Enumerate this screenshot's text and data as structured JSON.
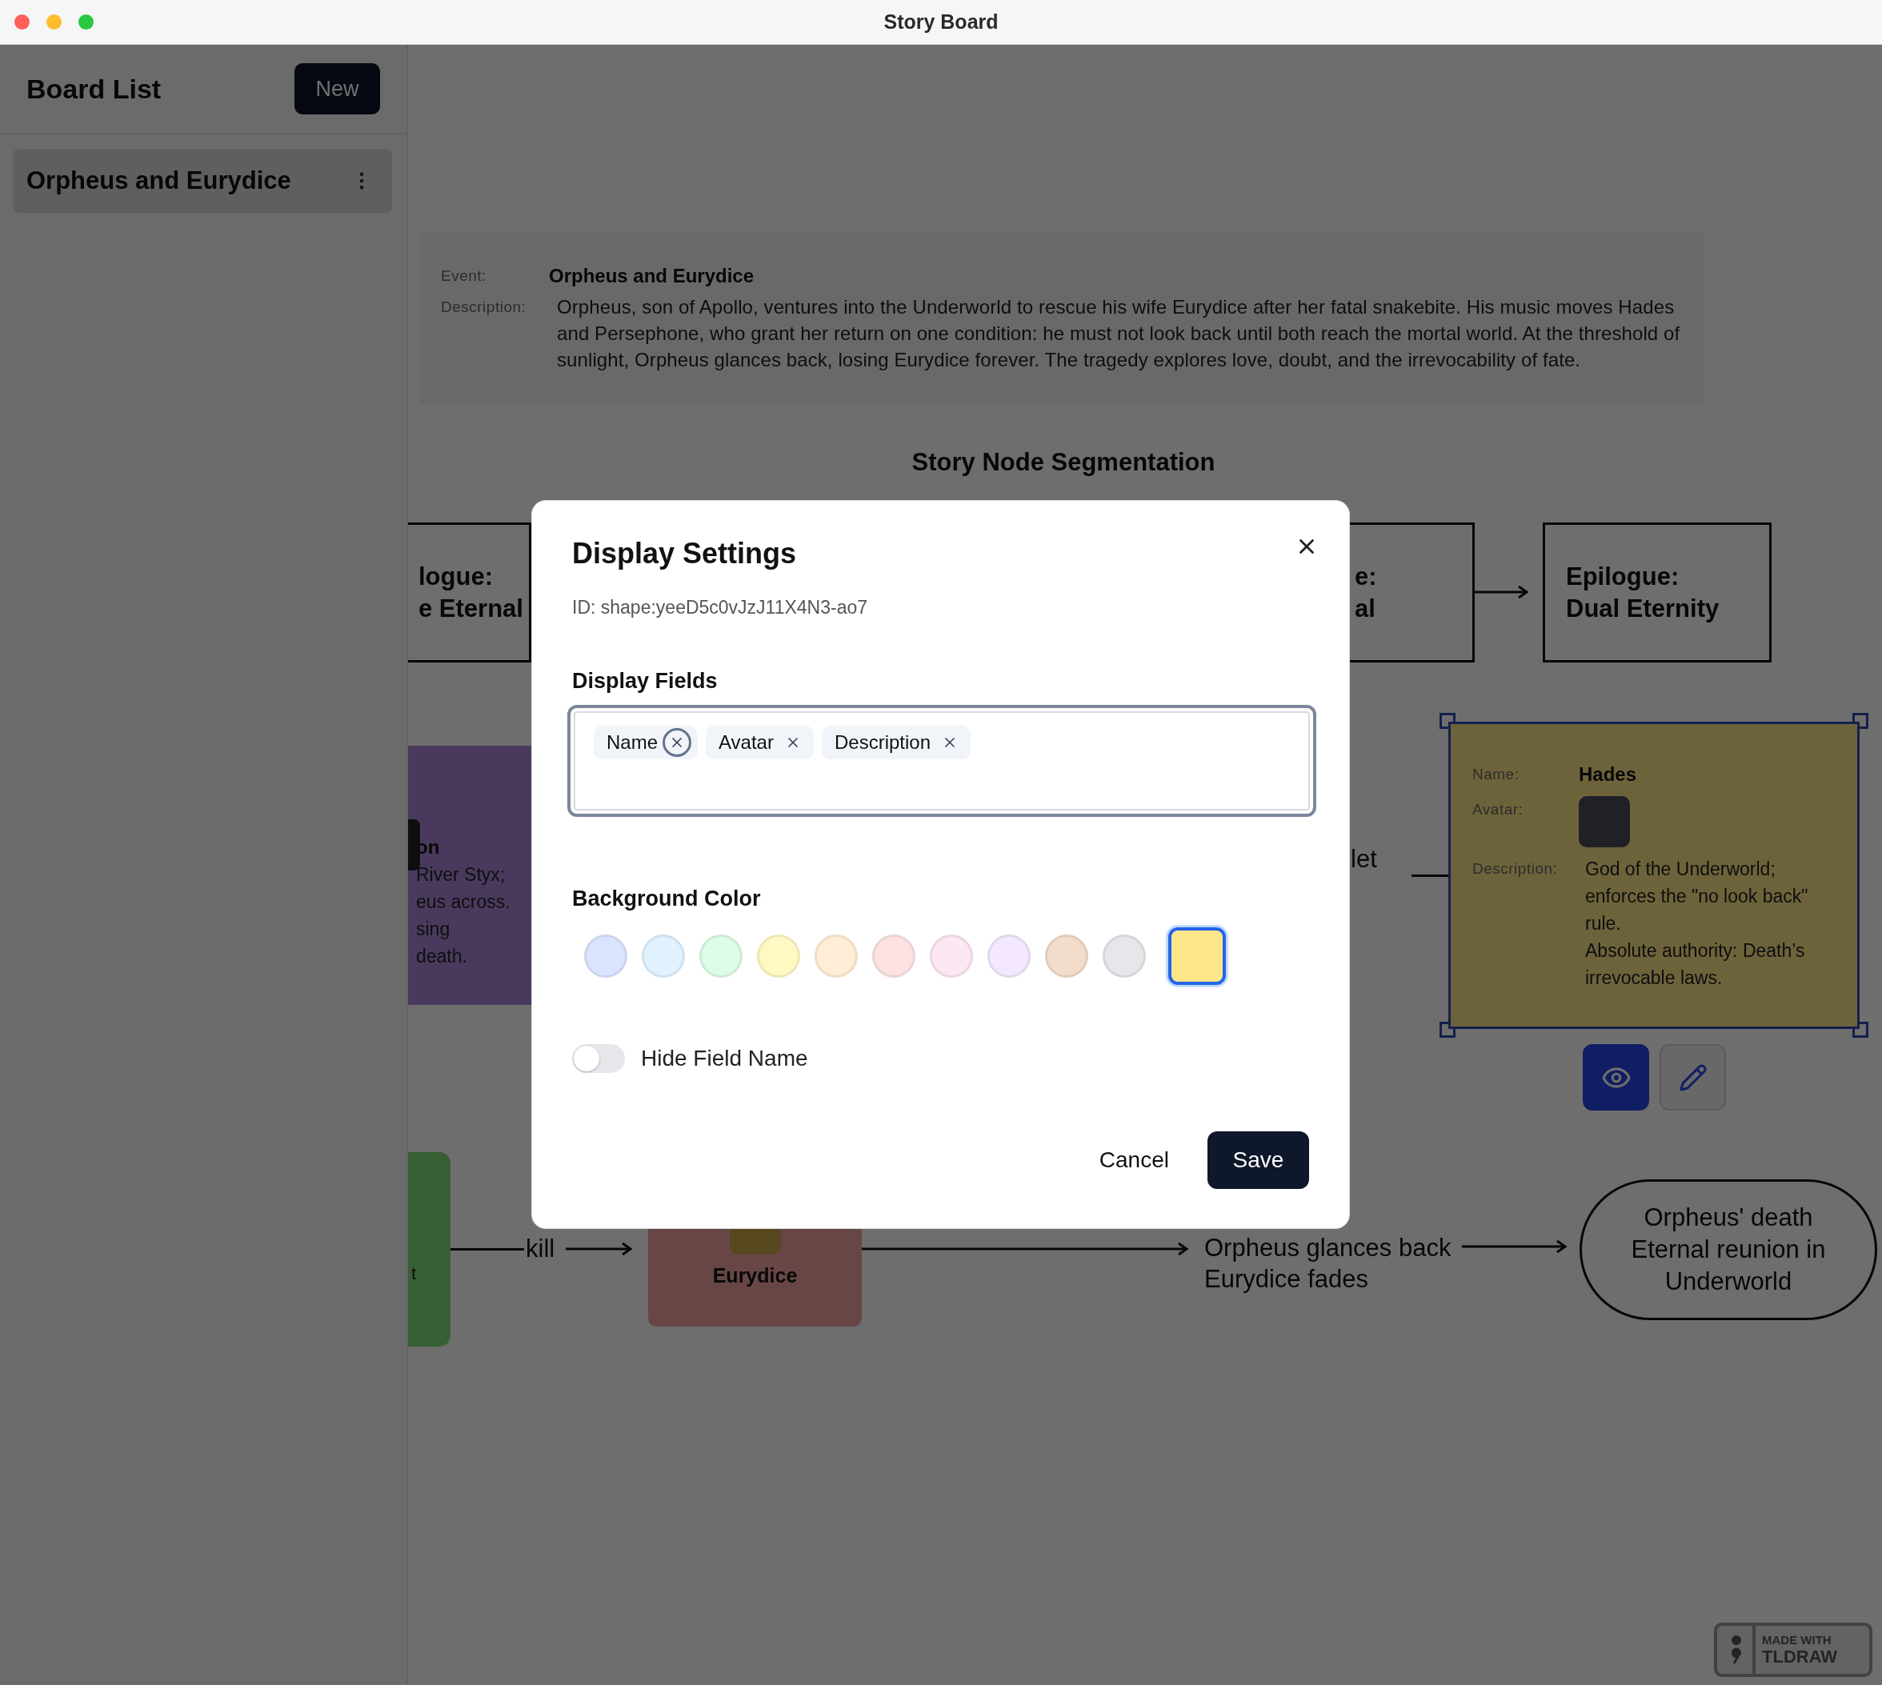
{
  "window": {
    "title": "Story Board"
  },
  "sidebar": {
    "title": "Board List",
    "new_button": "New",
    "boards": [
      {
        "name": "Orpheus and Eurydice",
        "selected": true
      }
    ]
  },
  "canvas": {
    "event_card": {
      "event_label": "Event:",
      "event": "Orpheus and Eurydice",
      "description_label": "Description:",
      "description": "Orpheus, son of Apollo, ventures into the Underworld to rescue his wife Eurydice after her fatal snakebite. His music moves Hades and Persephone, who grant her return on one condition: he must not look back until both reach the mortal world. At the threshold of sunlight, Orpheus glances back, losing Eurydice forever. The tragedy explores love, doubt, and the irrevocability of fate."
    },
    "section_title": "Story Node Segmentation",
    "segments": [
      {
        "lines": [
          "logue:",
          "e Eternal"
        ]
      },
      {
        "lines": [
          "e:",
          "al"
        ]
      },
      {
        "lines": [
          "Epilogue:",
          "Dual Eternity"
        ]
      }
    ],
    "purple_node": {
      "name": "on",
      "lines": [
        "River Styx;",
        "eus across.",
        "sing",
        "death."
      ]
    },
    "partial_label": "let",
    "hades_card": {
      "selected": true,
      "fields": [
        {
          "kind": "text",
          "label": "Name:",
          "value": "Hades"
        },
        {
          "kind": "image",
          "label": "Avatar:"
        },
        {
          "kind": "paragraphs",
          "label": "Description:",
          "paragraphs": [
            "God of the Underworld; enforces the \"no look back\" rule.",
            "Absolute authority: Death’s irrevocable laws."
          ]
        }
      ]
    },
    "card_tools": [
      {
        "kind": "view",
        "selected": true
      },
      {
        "kind": "edit",
        "selected": false
      }
    ],
    "green_node": {
      "text": "t"
    },
    "edge_label": "kill",
    "eurydice_node": {
      "name": "Eurydice"
    },
    "event_lines": [
      "Orpheus glances back",
      "Eurydice fades"
    ],
    "ending_node": {
      "lines": [
        "Orpheus' death",
        "Eternal reunion in",
        "Underworld"
      ]
    },
    "badge": {
      "line1": "MADE WITH",
      "line2": "TLDRAW"
    }
  },
  "dialog": {
    "title": "Display Settings",
    "id_text": "ID: shape:yeeD5c0vJzJ11X4N3-ao7",
    "fields_label": "Display Fields",
    "fields": [
      {
        "label": "Name",
        "focused": true
      },
      {
        "label": "Avatar",
        "focused": false
      },
      {
        "label": "Description",
        "focused": false
      }
    ],
    "color_label": "Background Color",
    "colors": [
      {
        "color": "#dbe4ff",
        "selected": false
      },
      {
        "color": "#e0f2fe",
        "selected": false
      },
      {
        "color": "#dcfce7",
        "selected": false
      },
      {
        "color": "#fef9c3",
        "selected": false
      },
      {
        "color": "#ffedd5",
        "selected": false
      },
      {
        "color": "#fee2e2",
        "selected": false
      },
      {
        "color": "#fce7f3",
        "selected": false
      },
      {
        "color": "#f3e8ff",
        "selected": false
      },
      {
        "color": "#f2dccb",
        "selected": false
      },
      {
        "color": "#e5e7eb",
        "selected": false
      },
      {
        "color": "#fde68a",
        "selected": true
      }
    ],
    "hide_field_name": {
      "label": "Hide Field Name",
      "on": false
    },
    "cancel": "Cancel",
    "save": "Save"
  }
}
